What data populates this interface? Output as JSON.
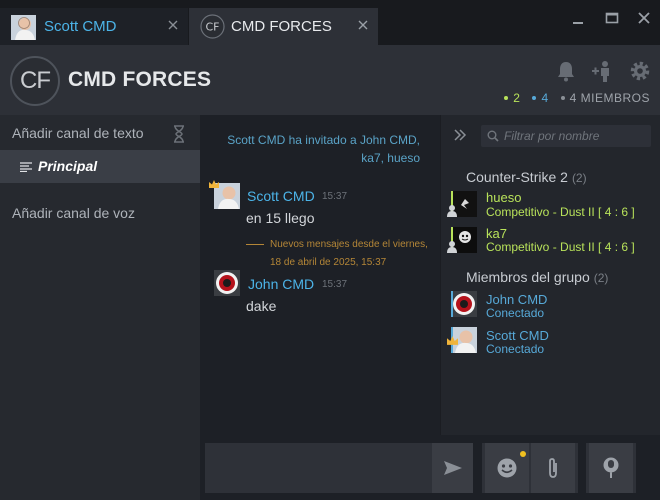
{
  "tabs": [
    {
      "label": "Scott CMD"
    },
    {
      "label": "CMD FORCES",
      "avatar_text": "CF"
    }
  ],
  "header": {
    "logo_text": "CF",
    "title": "CMD FORCES",
    "counts": {
      "in_game": "2",
      "online": "4",
      "members": "4 MIEMBROS"
    }
  },
  "sidebar": {
    "add_text_channel": "Añadir canal de texto",
    "active_channel": "Principal",
    "add_voice_channel": "Añadir canal de voz"
  },
  "chat": {
    "invite_notice": "Scott CMD ha invitado a John CMD, ka7, hueso",
    "messages": [
      {
        "author": "Scott CMD",
        "time": "15:37",
        "text": "en 15 llego"
      },
      {
        "author": "John CMD",
        "time": "15:37",
        "text": "dake"
      }
    ],
    "new_messages_divider": "Nuevos mensajes desde el viernes, 18 de abril de 2025, 15:37"
  },
  "members": {
    "filter_placeholder": "Filtrar por nombre",
    "sections": [
      {
        "title": "Counter-Strike 2",
        "count": "(2)",
        "members": [
          {
            "name": "hueso",
            "status": "Competitivo - Dust II [ 4 : 6 ]"
          },
          {
            "name": "ka7",
            "status": "Competitivo - Dust II [ 4 : 6 ]"
          }
        ]
      },
      {
        "title": "Miembros del grupo",
        "count": "(2)",
        "members": [
          {
            "name": "John CMD",
            "status": "Conectado"
          },
          {
            "name": "Scott CMD",
            "status": "Conectado"
          }
        ]
      }
    ]
  },
  "colors": {
    "accent_blue": "#4cb4e8",
    "in_game_green": "#b8e25a",
    "new_messages_gold": "#b48637",
    "notification_dot": "#f0c020"
  },
  "icons": {
    "notifications": "bell-icon",
    "invite": "add-friend-icon",
    "settings": "gear-icon",
    "collapse": "double-chevron-right-icon",
    "search": "search-icon",
    "send": "send-arrow-icon",
    "emoji": "emoji-icon",
    "attach": "paperclip-icon",
    "voice": "microphone-icon"
  }
}
